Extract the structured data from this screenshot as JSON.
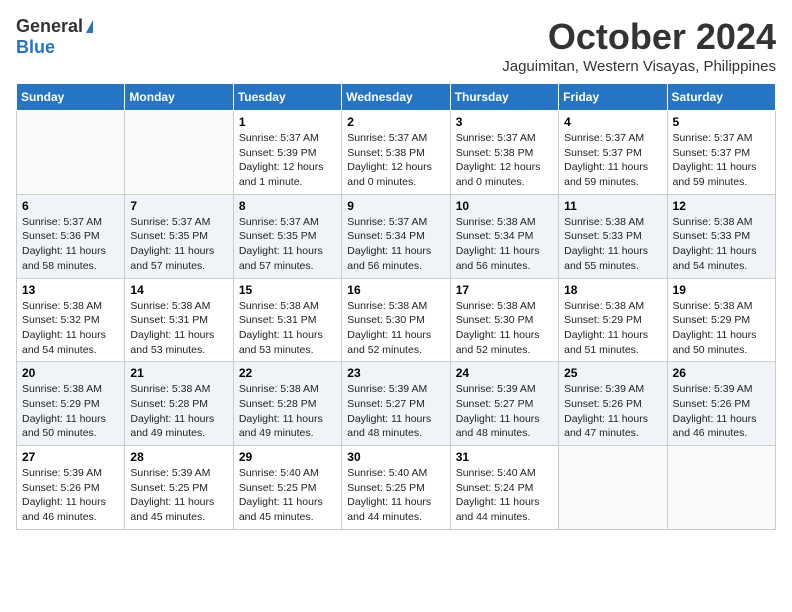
{
  "header": {
    "logo_general": "General",
    "logo_blue": "Blue",
    "month": "October 2024",
    "location": "Jaguimitan, Western Visayas, Philippines"
  },
  "days_of_week": [
    "Sunday",
    "Monday",
    "Tuesday",
    "Wednesday",
    "Thursday",
    "Friday",
    "Saturday"
  ],
  "weeks": [
    [
      {
        "day": "",
        "content": ""
      },
      {
        "day": "",
        "content": ""
      },
      {
        "day": "1",
        "content": "Sunrise: 5:37 AM\nSunset: 5:39 PM\nDaylight: 12 hours\nand 1 minute."
      },
      {
        "day": "2",
        "content": "Sunrise: 5:37 AM\nSunset: 5:38 PM\nDaylight: 12 hours\nand 0 minutes."
      },
      {
        "day": "3",
        "content": "Sunrise: 5:37 AM\nSunset: 5:38 PM\nDaylight: 12 hours\nand 0 minutes."
      },
      {
        "day": "4",
        "content": "Sunrise: 5:37 AM\nSunset: 5:37 PM\nDaylight: 11 hours\nand 59 minutes."
      },
      {
        "day": "5",
        "content": "Sunrise: 5:37 AM\nSunset: 5:37 PM\nDaylight: 11 hours\nand 59 minutes."
      }
    ],
    [
      {
        "day": "6",
        "content": "Sunrise: 5:37 AM\nSunset: 5:36 PM\nDaylight: 11 hours\nand 58 minutes."
      },
      {
        "day": "7",
        "content": "Sunrise: 5:37 AM\nSunset: 5:35 PM\nDaylight: 11 hours\nand 57 minutes."
      },
      {
        "day": "8",
        "content": "Sunrise: 5:37 AM\nSunset: 5:35 PM\nDaylight: 11 hours\nand 57 minutes."
      },
      {
        "day": "9",
        "content": "Sunrise: 5:37 AM\nSunset: 5:34 PM\nDaylight: 11 hours\nand 56 minutes."
      },
      {
        "day": "10",
        "content": "Sunrise: 5:38 AM\nSunset: 5:34 PM\nDaylight: 11 hours\nand 56 minutes."
      },
      {
        "day": "11",
        "content": "Sunrise: 5:38 AM\nSunset: 5:33 PM\nDaylight: 11 hours\nand 55 minutes."
      },
      {
        "day": "12",
        "content": "Sunrise: 5:38 AM\nSunset: 5:33 PM\nDaylight: 11 hours\nand 54 minutes."
      }
    ],
    [
      {
        "day": "13",
        "content": "Sunrise: 5:38 AM\nSunset: 5:32 PM\nDaylight: 11 hours\nand 54 minutes."
      },
      {
        "day": "14",
        "content": "Sunrise: 5:38 AM\nSunset: 5:31 PM\nDaylight: 11 hours\nand 53 minutes."
      },
      {
        "day": "15",
        "content": "Sunrise: 5:38 AM\nSunset: 5:31 PM\nDaylight: 11 hours\nand 53 minutes."
      },
      {
        "day": "16",
        "content": "Sunrise: 5:38 AM\nSunset: 5:30 PM\nDaylight: 11 hours\nand 52 minutes."
      },
      {
        "day": "17",
        "content": "Sunrise: 5:38 AM\nSunset: 5:30 PM\nDaylight: 11 hours\nand 52 minutes."
      },
      {
        "day": "18",
        "content": "Sunrise: 5:38 AM\nSunset: 5:29 PM\nDaylight: 11 hours\nand 51 minutes."
      },
      {
        "day": "19",
        "content": "Sunrise: 5:38 AM\nSunset: 5:29 PM\nDaylight: 11 hours\nand 50 minutes."
      }
    ],
    [
      {
        "day": "20",
        "content": "Sunrise: 5:38 AM\nSunset: 5:29 PM\nDaylight: 11 hours\nand 50 minutes."
      },
      {
        "day": "21",
        "content": "Sunrise: 5:38 AM\nSunset: 5:28 PM\nDaylight: 11 hours\nand 49 minutes."
      },
      {
        "day": "22",
        "content": "Sunrise: 5:38 AM\nSunset: 5:28 PM\nDaylight: 11 hours\nand 49 minutes."
      },
      {
        "day": "23",
        "content": "Sunrise: 5:39 AM\nSunset: 5:27 PM\nDaylight: 11 hours\nand 48 minutes."
      },
      {
        "day": "24",
        "content": "Sunrise: 5:39 AM\nSunset: 5:27 PM\nDaylight: 11 hours\nand 48 minutes."
      },
      {
        "day": "25",
        "content": "Sunrise: 5:39 AM\nSunset: 5:26 PM\nDaylight: 11 hours\nand 47 minutes."
      },
      {
        "day": "26",
        "content": "Sunrise: 5:39 AM\nSunset: 5:26 PM\nDaylight: 11 hours\nand 46 minutes."
      }
    ],
    [
      {
        "day": "27",
        "content": "Sunrise: 5:39 AM\nSunset: 5:26 PM\nDaylight: 11 hours\nand 46 minutes."
      },
      {
        "day": "28",
        "content": "Sunrise: 5:39 AM\nSunset: 5:25 PM\nDaylight: 11 hours\nand 45 minutes."
      },
      {
        "day": "29",
        "content": "Sunrise: 5:40 AM\nSunset: 5:25 PM\nDaylight: 11 hours\nand 45 minutes."
      },
      {
        "day": "30",
        "content": "Sunrise: 5:40 AM\nSunset: 5:25 PM\nDaylight: 11 hours\nand 44 minutes."
      },
      {
        "day": "31",
        "content": "Sunrise: 5:40 AM\nSunset: 5:24 PM\nDaylight: 11 hours\nand 44 minutes."
      },
      {
        "day": "",
        "content": ""
      },
      {
        "day": "",
        "content": ""
      }
    ]
  ]
}
